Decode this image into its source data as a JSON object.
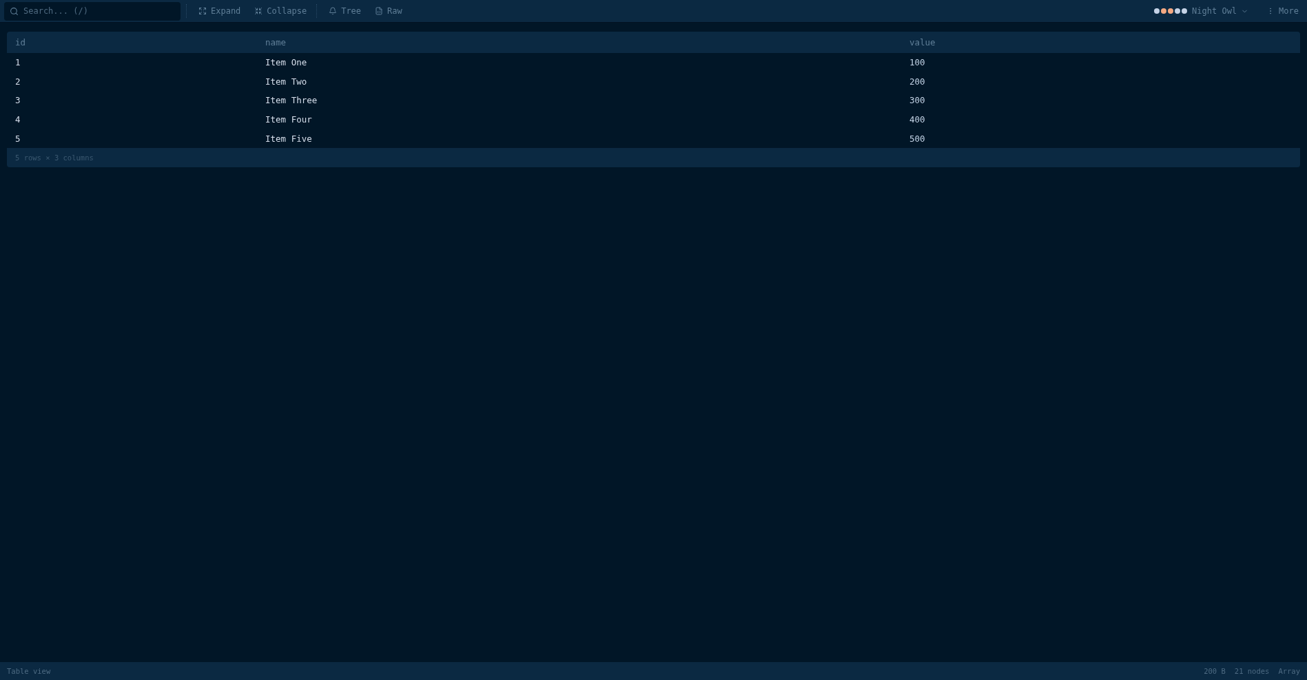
{
  "toolbar": {
    "search": {
      "placeholder": "Search... (/)"
    },
    "action_groups": [
      [
        {
          "kind": "expand",
          "label": "Expand"
        },
        {
          "kind": "collapse",
          "label": "Collapse"
        }
      ],
      [
        {
          "kind": "tree",
          "label": "Tree"
        },
        {
          "kind": "raw",
          "label": "Raw"
        }
      ]
    ],
    "theme": {
      "swatches": [
        {
          "color": "#c5d2e6"
        },
        {
          "color": "#f4a882"
        },
        {
          "color": "#f4a882"
        },
        {
          "color": "#c5d2e6"
        },
        {
          "color": "#c5d2e6"
        }
      ],
      "label": "Night Owl"
    },
    "more": {
      "label": "More"
    }
  },
  "table": {
    "columns": [
      "id",
      "name",
      "value"
    ],
    "rows": [
      [
        "1",
        "Item One",
        "100"
      ],
      [
        "2",
        "Item Two",
        "200"
      ],
      [
        "3",
        "Item Three",
        "300"
      ],
      [
        "4",
        "Item Four",
        "400"
      ],
      [
        "5",
        "Item Five",
        "500"
      ]
    ],
    "footer": "5 rows × 3 columns"
  },
  "status_bar": {
    "left": "Table view",
    "right": [
      "200 B",
      "21 nodes",
      "Array"
    ]
  }
}
